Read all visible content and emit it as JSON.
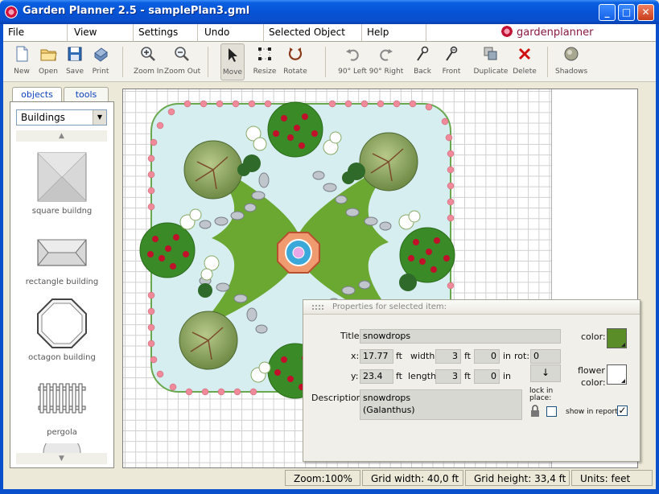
{
  "window": {
    "title": "Garden Planner 2.5 - samplePlan3.gml",
    "min": "_",
    "max": "□",
    "close": "✕"
  },
  "menu": {
    "items": [
      "File",
      "View",
      "Settings",
      "Undo",
      "Selected Object",
      "Help"
    ],
    "brand": "gardenplanner"
  },
  "toolbar": {
    "new": "New",
    "open": "Open",
    "save": "Save",
    "print": "Print",
    "zoom_in": "Zoom In",
    "zoom_out": "Zoom Out",
    "move": "Move",
    "resize": "Resize",
    "rotate": "Rotate",
    "rotate_left": "90° Left",
    "rotate_right": "90° Right",
    "back": "Back",
    "front": "Front",
    "duplicate": "Duplicate",
    "delete": "Delete",
    "shadows": "Shadows"
  },
  "left_panel": {
    "tabs": [
      "objects",
      "tools"
    ],
    "category": "Buildings",
    "objects": [
      "square buildng",
      "rectangle building",
      "octagon building",
      "pergola"
    ]
  },
  "properties": {
    "header": "Properties for selected item:",
    "title_label": "Title:",
    "title_value": "snowdrops",
    "x_label": "x:",
    "x_value": "17.77",
    "y_label": "y:",
    "y_value": "23.4",
    "ft": "ft",
    "in": "in",
    "width_label": "width:",
    "width_ft": "3",
    "width_in": "0",
    "length_label": "length:",
    "length_ft": "3",
    "length_in": "0",
    "rot_label": "rot:",
    "rot_value": "0",
    "rot_arrow": "↓",
    "description_label": "Description:",
    "description_line1": "snowdrops",
    "description_line2": "(Galanthus)",
    "color_label": "color:",
    "flower_color_label_1": "flower",
    "flower_color_label_2": "color:",
    "lock_label_1": "lock in",
    "lock_label_2": "place:",
    "show_in_report_label": "show in report:",
    "show_in_report_check": "✓",
    "color": "#5a8c28",
    "flower_color": "#ffffff"
  },
  "status": {
    "zoom": "Zoom:100%",
    "grid_width": "Grid width: 40,0 ft",
    "grid_height": "Grid height: 33,4 ft",
    "units": "Units: feet"
  }
}
